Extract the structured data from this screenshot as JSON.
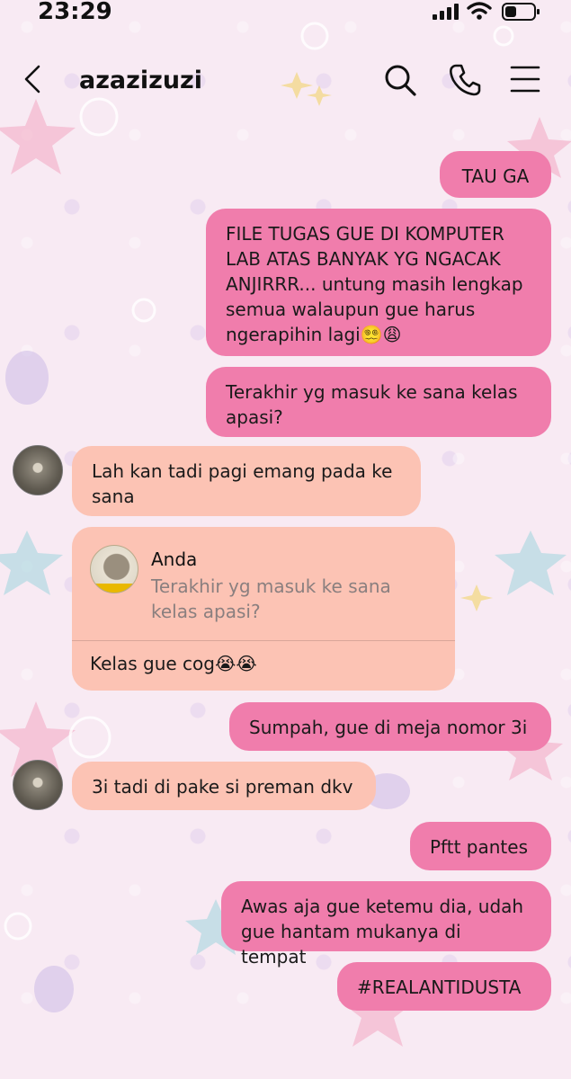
{
  "status_bar": {
    "time": "23:29"
  },
  "header": {
    "username": "azazizuzi"
  },
  "messages": {
    "m1": "TAU GA",
    "m2": "FILE TUGAS GUE DI KOMPUTER LAB ATAS BANYAK YG NGACAK ANJIRRR... untung masih lengkap semua walaupun gue harus ngerapihin lagi😵‍💫😩",
    "m3": "Terakhir yg masuk ke sana kelas apasi?",
    "m4": "Lah kan tadi pagi emang pada ke sana",
    "m5_reply_name": "Anda",
    "m5_reply_quote": "Terakhir yg masuk ke sana kelas apasi?",
    "m5": "Kelas gue cog😭😭",
    "m6": "Sumpah, gue di meja nomor 3i",
    "m7": "3i tadi di pake si preman dkv",
    "m8": "Pftt pantes",
    "m9": "Awas aja gue ketemu dia, udah gue hantam mukanya di tempat",
    "m10": "#REALANTIDUSTA"
  },
  "colors": {
    "outgoing_bubble": "#f07dac",
    "incoming_bubble": "#fcc3b4",
    "background": "#f8eaf3"
  },
  "icons": [
    "back-arrow-icon",
    "search-icon",
    "phone-icon",
    "menu-icon",
    "signal-icon",
    "wifi-icon",
    "battery-icon"
  ]
}
